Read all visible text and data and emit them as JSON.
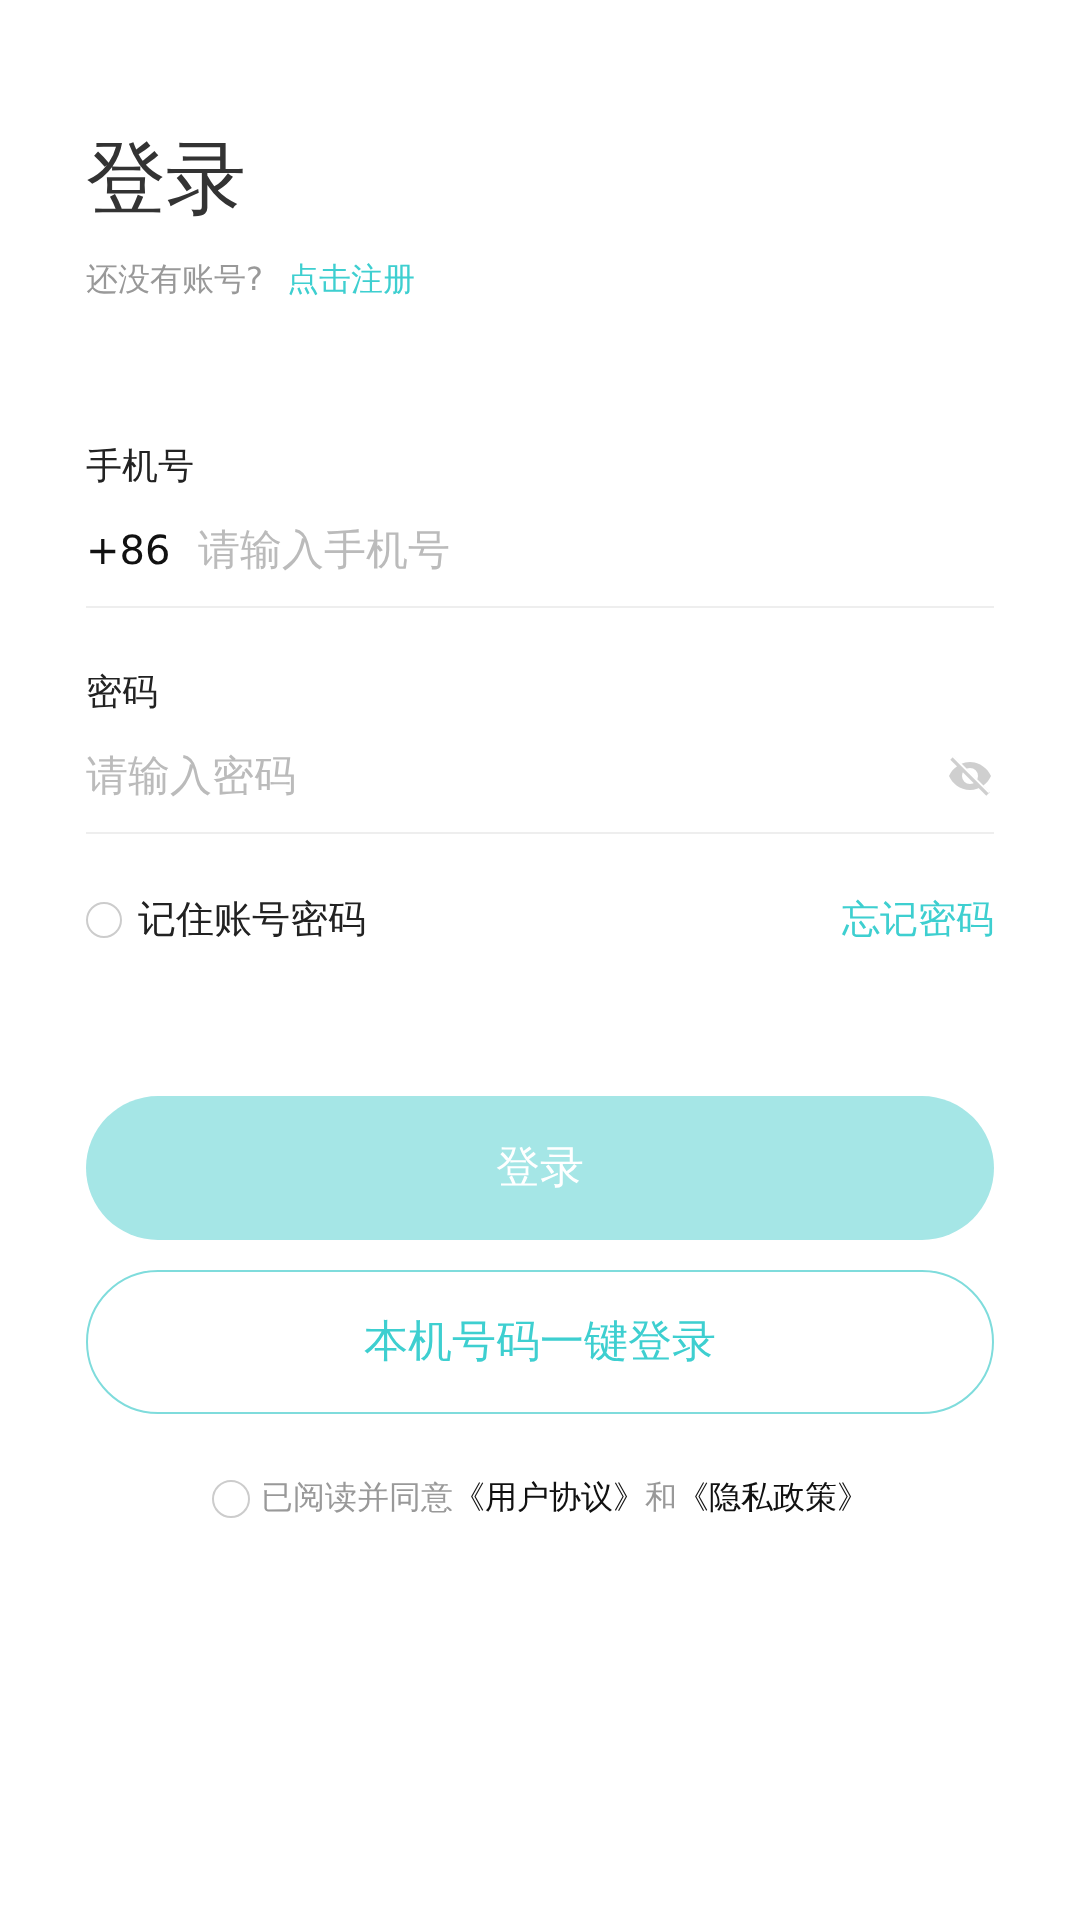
{
  "title": "登录",
  "signup": {
    "prompt": "还没有账号?",
    "link": "点击注册"
  },
  "phone": {
    "label": "手机号",
    "prefix": "+86",
    "placeholder": "请输入手机号"
  },
  "password": {
    "label": "密码",
    "placeholder": "请输入密码",
    "visible": false
  },
  "remember": {
    "label": "记住账号密码",
    "checked": false
  },
  "forgot": "忘记密码",
  "login_button": {
    "label": "登录",
    "disabled": true
  },
  "one_tap_button": "本机号码一键登录",
  "agreement": {
    "checked": false,
    "parts": [
      {
        "kind": "text",
        "text": "已阅读并同意"
      },
      {
        "kind": "link",
        "text": "《用户协议》"
      },
      {
        "kind": "text",
        "text": "和"
      },
      {
        "kind": "link",
        "text": "《隐私政策》"
      }
    ]
  }
}
